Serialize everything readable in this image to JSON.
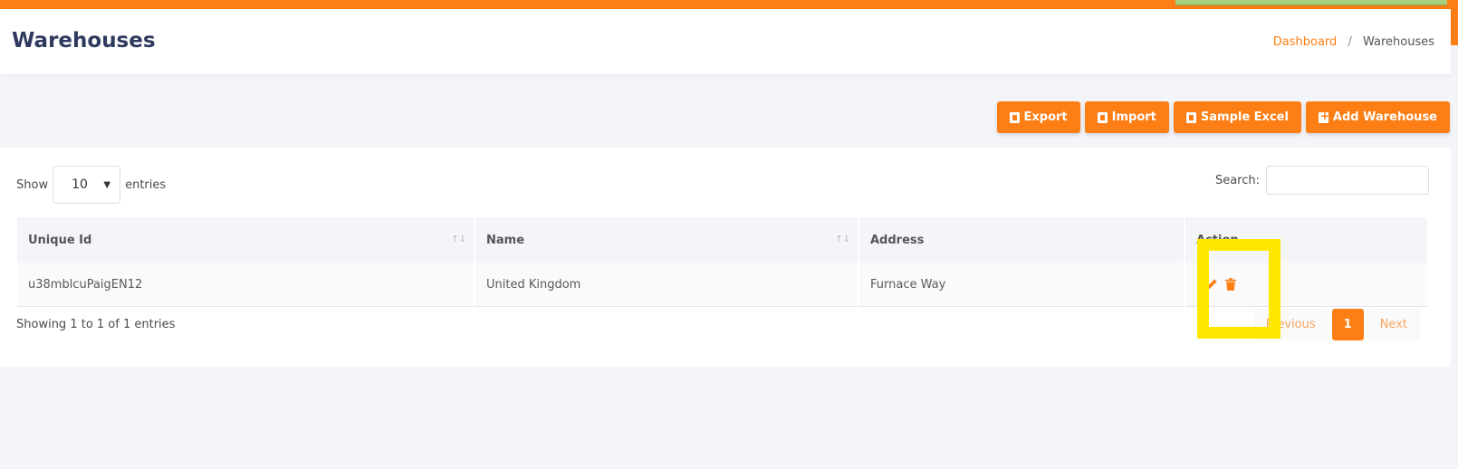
{
  "header": {
    "title": "Warehouses",
    "breadcrumb": {
      "home": "Dashboard",
      "separator": "/",
      "current": "Warehouses"
    }
  },
  "actions": {
    "export": "Export",
    "import": "Import",
    "sample_excel": "Sample Excel",
    "add_warehouse": "Add Warehouse"
  },
  "table_controls": {
    "show_label": "Show",
    "entries_value": "10",
    "entries_label": "entries",
    "search_label": "Search:",
    "search_value": ""
  },
  "table": {
    "columns": [
      "Unique Id",
      "Name",
      "Address",
      "Action"
    ],
    "rows": [
      {
        "unique_id": "u38mblcuPaigEN12",
        "name": "United Kingdom",
        "address": "Furnace Way"
      }
    ]
  },
  "footer": {
    "info": "Showing 1 to 1 of 1 entries",
    "previous": "Previous",
    "current_page": "1",
    "next": "Next"
  },
  "colors": {
    "accent": "#fd7e14",
    "highlight": "#ffe800",
    "title": "#2f3a5f"
  },
  "icons": {
    "export": "file-download-icon",
    "import": "file-import-icon",
    "sample_excel": "file-download-icon",
    "add": "plus-square-icon",
    "edit": "pencil-icon",
    "delete": "trash-icon"
  }
}
